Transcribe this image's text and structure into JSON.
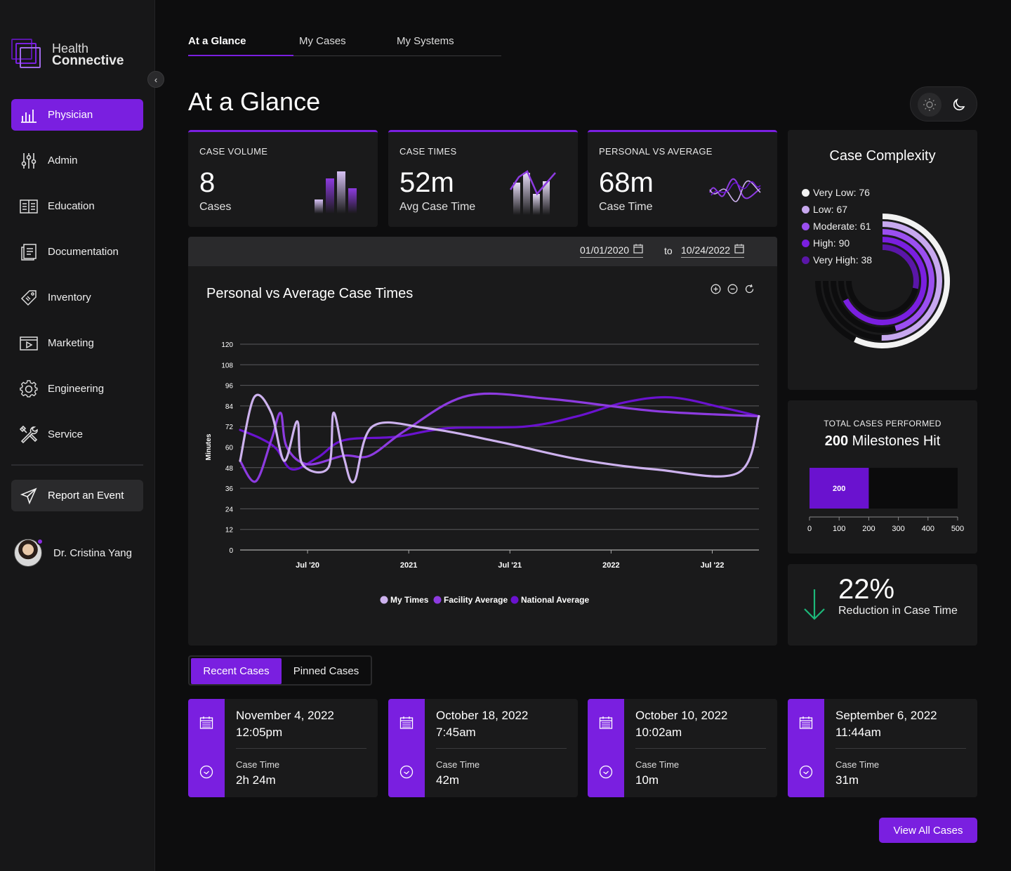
{
  "app": {
    "logo_line1": "Health",
    "logo_line2": "Connective"
  },
  "sidebar": {
    "items": [
      {
        "label": "Physician"
      },
      {
        "label": "Admin"
      },
      {
        "label": "Education"
      },
      {
        "label": "Documentation"
      },
      {
        "label": "Inventory"
      },
      {
        "label": "Marketing"
      },
      {
        "label": "Engineering"
      },
      {
        "label": "Service"
      }
    ],
    "report_label": "Report an Event",
    "user_name": "Dr. Cristina Yang"
  },
  "tabs": [
    "At a Glance",
    "My Cases",
    "My Systems"
  ],
  "page_title": "At a Glance",
  "kpis": [
    {
      "label": "CASE VOLUME",
      "value": "8",
      "sub": "Cases"
    },
    {
      "label": "CASE TIMES",
      "value": "52m",
      "sub": "Avg Case Time"
    },
    {
      "label": "PERSONAL VS AVERAGE",
      "value": "68m",
      "sub": "Case Time"
    }
  ],
  "date_range": {
    "from": "01/01/2020",
    "to_label": "to",
    "to": "10/24/2022"
  },
  "chart_data": [
    {
      "type": "line",
      "title": "Personal vs Average Case Times",
      "ylabel": "Minutes",
      "xlabel": "",
      "ylim": [
        0,
        120
      ],
      "yticks": [
        0,
        12,
        24,
        36,
        48,
        60,
        72,
        84,
        96,
        108,
        120
      ],
      "xticks": [
        {
          "label": "Jul '20",
          "t": 0.13
        },
        {
          "label": "2021",
          "t": 0.325
        },
        {
          "label": "Jul '21",
          "t": 0.52
        },
        {
          "label": "2022",
          "t": 0.715
        },
        {
          "label": "Jul '22",
          "t": 0.91
        }
      ],
      "legend_position": "bottom",
      "grid": true,
      "series": [
        {
          "name": "My Times",
          "color": "#cdb2ee",
          "points": [
            [
              0.0,
              52
            ],
            [
              0.027,
              89
            ],
            [
              0.06,
              80
            ],
            [
              0.085,
              52
            ],
            [
              0.11,
              75
            ],
            [
              0.12,
              50
            ],
            [
              0.17,
              48
            ],
            [
              0.18,
              80
            ],
            [
              0.2,
              54
            ],
            [
              0.22,
              40
            ],
            [
              0.255,
              72
            ],
            [
              0.36,
              71
            ],
            [
              0.5,
              63
            ],
            [
              0.65,
              53
            ],
            [
              0.8,
              47
            ],
            [
              0.96,
              45
            ],
            [
              1.0,
              78
            ]
          ]
        },
        {
          "name": "Facility Average",
          "color": "#8d3be0",
          "points": [
            [
              0.0,
              52
            ],
            [
              0.03,
              40
            ],
            [
              0.06,
              64
            ],
            [
              0.078,
              80
            ],
            [
              0.09,
              60
            ],
            [
              0.13,
              50
            ],
            [
              0.2,
              55
            ],
            [
              0.25,
              55
            ],
            [
              0.32,
              70
            ],
            [
              0.44,
              90
            ],
            [
              0.6,
              88
            ],
            [
              0.8,
              81
            ],
            [
              1.0,
              78
            ]
          ]
        },
        {
          "name": "National Average",
          "color": "#6a12cf",
          "points": [
            [
              0.0,
              70
            ],
            [
              0.04,
              65
            ],
            [
              0.07,
              59
            ],
            [
              0.1,
              47
            ],
            [
              0.15,
              54
            ],
            [
              0.2,
              64
            ],
            [
              0.3,
              66
            ],
            [
              0.4,
              71
            ],
            [
              0.55,
              72
            ],
            [
              0.65,
              78
            ],
            [
              0.74,
              86
            ],
            [
              0.83,
              89
            ],
            [
              0.93,
              83
            ],
            [
              1.0,
              78
            ]
          ]
        }
      ]
    },
    {
      "type": "radial-bar",
      "title": "Case Complexity",
      "legend_position": "top-left",
      "series": [
        {
          "name": "Very Low",
          "value": 76,
          "color": "#f2f2f2"
        },
        {
          "name": "Low",
          "value": 67,
          "color": "#c7a8ef"
        },
        {
          "name": "Moderate",
          "value": 61,
          "color": "#9b4ff0"
        },
        {
          "name": "High",
          "value": 90,
          "color": "#7a1fe0"
        },
        {
          "name": "Very High",
          "value": 38,
          "color": "#5a16a8"
        }
      ]
    },
    {
      "type": "bar",
      "title": "TOTAL CASES PERFORMED",
      "categories": [
        "Total"
      ],
      "values": [
        200
      ],
      "xlim": [
        0,
        500
      ],
      "xticks": [
        0,
        100,
        200,
        300,
        400,
        500
      ],
      "data_label": "200"
    }
  ],
  "total_cases": {
    "label": "TOTAL CASES PERFORMED",
    "count": "200",
    "suffix": " Milestones Hit"
  },
  "reduction": {
    "pct": "22%",
    "desc": "Reduction in Case Time"
  },
  "case_tabs": [
    "Recent Cases",
    "Pinned Cases"
  ],
  "cases": [
    {
      "date": "November 4, 2022",
      "time": "12:05pm",
      "case_time_label": "Case Time",
      "case_time": "2h 24m"
    },
    {
      "date": "October 18, 2022",
      "time": "7:45am",
      "case_time_label": "Case Time",
      "case_time": "42m"
    },
    {
      "date": "October 10, 2022",
      "time": "10:02am",
      "case_time_label": "Case Time",
      "case_time": "10m"
    },
    {
      "date": "September 6, 2022",
      "time": "11:44am",
      "case_time_label": "Case Time",
      "case_time": "31m"
    }
  ],
  "view_all_label": "View All Cases",
  "colors": {
    "accent": "#7a1fe0",
    "bg": "#0d0d0e",
    "card": "#1a1a1b",
    "down_arrow": "#1db87a"
  },
  "icons": [
    "bar-chart-icon",
    "sliders-icon",
    "book-icon",
    "document-icon",
    "tag-icon",
    "media-icon",
    "gear-icon",
    "tools-icon",
    "send-icon",
    "calendar-icon",
    "clock-icon",
    "sun-icon",
    "moon-icon",
    "zoom-in-icon",
    "zoom-out-icon",
    "reset-icon",
    "arrow-down-icon",
    "chevron-left-icon"
  ]
}
